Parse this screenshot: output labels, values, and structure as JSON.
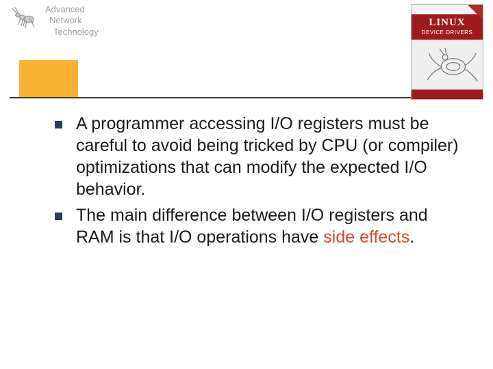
{
  "header": {
    "logo_lines": [
      "Advanced",
      "Network",
      "Technology"
    ],
    "book": {
      "title_line1": "LINUX",
      "title_line2": "DEVICE DRIVERS",
      "footer": ""
    }
  },
  "bullets": [
    {
      "text_before": "A programmer accessing I/O registers must be careful to avoid being tricked by CPU (or compiler) optimizations that can modify the expected I/O behavior.",
      "emphasis": "",
      "text_after": ""
    },
    {
      "text_before": "The main difference between I/O registers and RAM is that I/O operations have ",
      "emphasis": "side effects",
      "text_after": "."
    }
  ]
}
